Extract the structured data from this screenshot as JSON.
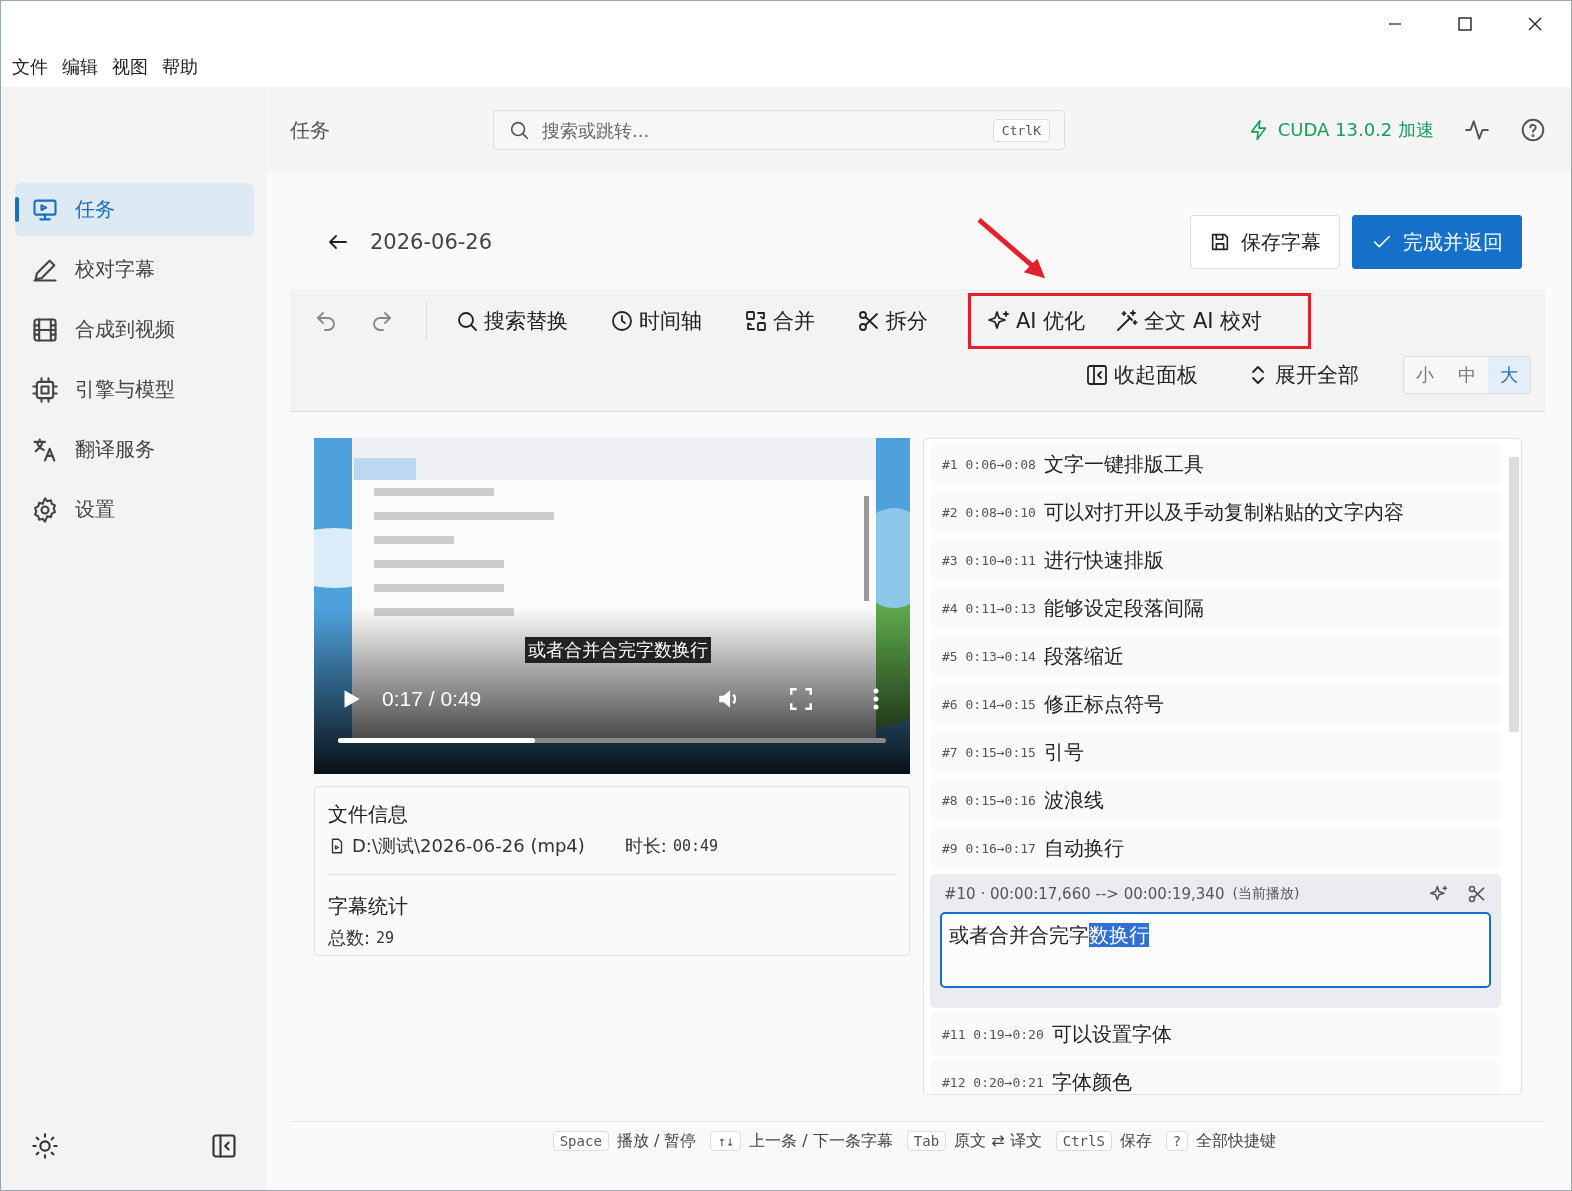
{
  "menu": [
    "文件",
    "编辑",
    "视图",
    "帮助"
  ],
  "sidebar": {
    "items": [
      {
        "label": "任务",
        "selected": true
      },
      {
        "label": "校对字幕",
        "selected": false
      },
      {
        "label": "合成到视频",
        "selected": false
      },
      {
        "label": "引擎与模型",
        "selected": false
      },
      {
        "label": "翻译服务",
        "selected": false
      },
      {
        "label": "设置",
        "selected": false
      }
    ]
  },
  "topbar": {
    "title": "任务",
    "search": {
      "placeholder": "搜索或跳转...",
      "shortcut": "CtrlK"
    },
    "gpu_status": "CUDA 13.0.2 加速"
  },
  "editor": {
    "title": "2026-06-26",
    "buttons": [
      {
        "label": "保存字幕",
        "kind": "secondary"
      },
      {
        "label": "完成并返回",
        "kind": "primary"
      }
    ],
    "tools": [
      "搜索替换",
      "时间轴",
      "合并",
      "拆分"
    ],
    "ai_tools": [
      "AI 优化",
      "全文 AI 校对"
    ],
    "collapse": "收起面板",
    "expand": "展开全部",
    "sizes": [
      {
        "label": "小",
        "selected": false
      },
      {
        "label": "中",
        "selected": false
      },
      {
        "label": "大",
        "selected": true
      }
    ]
  },
  "video": {
    "subtitle": "或者合并合完字数换行",
    "time": "0:17 / 0:49",
    "level": 0.36
  },
  "file_info": {
    "title": "文件信息",
    "path": "D:\\测试\\2026-06-26 (mp4)",
    "duration_label": "时长:",
    "duration": "00:49"
  },
  "stats": {
    "title": "字幕统计",
    "total_label": "总数:",
    "total": "29"
  },
  "subtitles": [
    {
      "kind": "row",
      "index": "#1",
      "time": "0:06→0:08",
      "text": "文字一键排版工具"
    },
    {
      "kind": "row",
      "index": "#2",
      "time": "0:08→0:10",
      "text": "可以对打开以及手动复制粘贴的文字内容"
    },
    {
      "kind": "row",
      "index": "#3",
      "time": "0:10→0:11",
      "text": "进行快速排版"
    },
    {
      "kind": "row",
      "index": "#4",
      "time": "0:11→0:13",
      "text": "能够设定段落间隔"
    },
    {
      "kind": "row",
      "index": "#5",
      "time": "0:13→0:14",
      "text": "段落缩近"
    },
    {
      "kind": "row",
      "index": "#6",
      "time": "0:14→0:15",
      "text": "修正标点符号"
    },
    {
      "kind": "row",
      "index": "#7",
      "time": "0:15→0:15",
      "text": "引号"
    },
    {
      "kind": "row",
      "index": "#8",
      "time": "0:15→0:16",
      "text": "波浪线"
    },
    {
      "kind": "row",
      "index": "#9",
      "time": "0:16→0:17",
      "text": "自动换行"
    },
    {
      "kind": "active",
      "header": "#10 · 00:00:17,660 --> 00:00:19,340",
      "status": "(当前播放)",
      "text": "或者合并合完字",
      "selected_text": "数换行"
    },
    {
      "kind": "row",
      "index": "#11",
      "time": "0:19→0:20",
      "text": "可以设置字体"
    },
    {
      "kind": "row",
      "index": "#12",
      "time": "0:20→0:21",
      "text": "字体颜色"
    }
  ],
  "shortcuts": [
    {
      "key": "Space",
      "label": "播放 / 暂停"
    },
    {
      "key": "↑↓",
      "label": "上一条 / 下一条字幕"
    },
    {
      "key": "Tab",
      "label": "原文 ⇄ 译文"
    },
    {
      "key": "CtrlS",
      "label": "保存"
    },
    {
      "key": "?",
      "label": "全部快捷键"
    }
  ]
}
